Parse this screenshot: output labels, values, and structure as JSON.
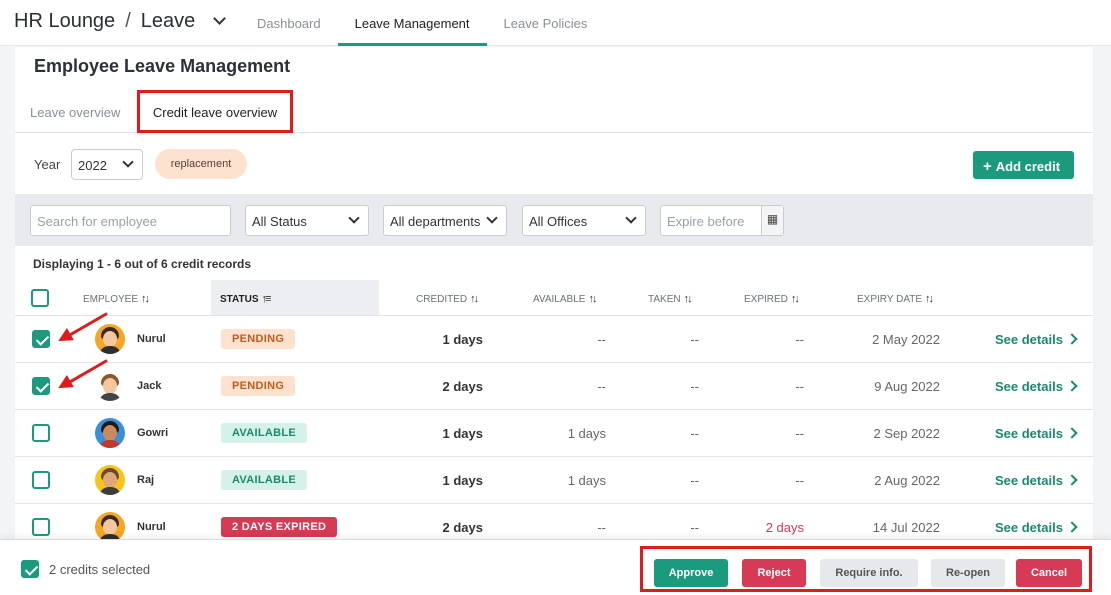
{
  "header": {
    "app_name": "HR Lounge",
    "separator": "/",
    "module": "Leave",
    "nav": [
      "Dashboard",
      "Leave Management",
      "Leave Policies"
    ],
    "active_nav": "Leave Management"
  },
  "page": {
    "title": "Employee Leave Management",
    "tabs": [
      "Leave overview",
      "Credit leave overview"
    ],
    "active_tab": "Credit leave overview"
  },
  "toolbar": {
    "year_label": "Year",
    "year_value": "2022",
    "tag": "replacement",
    "add_credit": "Add credit",
    "add_icon": "plus-icon"
  },
  "filters": {
    "search_placeholder": "Search for employee",
    "status": "All Status",
    "departments": "All departments",
    "offices": "All Offices",
    "expire_placeholder": "Expire before",
    "calendar_icon": "calendar-icon"
  },
  "table": {
    "summary": "Displaying 1 - 6 out of 6 credit records",
    "columns": {
      "employee": "EMPLOYEE",
      "status": "STATUS",
      "credited": "CREDITED",
      "available": "AVAILABLE",
      "taken": "TAKEN",
      "expired": "EXPIRED",
      "expiry_date": "EXPIRY DATE"
    },
    "rows": [
      {
        "name": "Nurul",
        "status": "PENDING",
        "credited": "1 days",
        "available": "--",
        "taken": "--",
        "expired": "--",
        "expiry": "2 May 2022",
        "action": "See details",
        "checked": true
      },
      {
        "name": "Jack",
        "status": "PENDING",
        "credited": "2 days",
        "available": "--",
        "taken": "--",
        "expired": "--",
        "expiry": "9 Aug 2022",
        "action": "See details",
        "checked": true
      },
      {
        "name": "Gowri",
        "status": "AVAILABLE",
        "credited": "1 days",
        "available": "1 days",
        "taken": "--",
        "expired": "--",
        "expiry": "2 Sep 2022",
        "action": "See details",
        "checked": false
      },
      {
        "name": "Raj",
        "status": "AVAILABLE",
        "credited": "1 days",
        "available": "1 days",
        "taken": "--",
        "expired": "--",
        "expiry": "2 Aug 2022",
        "action": "See details",
        "checked": false
      },
      {
        "name": "Nurul",
        "status": "2 DAYS EXPIRED",
        "credited": "2 days",
        "available": "--",
        "taken": "--",
        "expired": "2 days",
        "expiry": "14 Jul 2022",
        "action": "See details",
        "checked": false
      }
    ]
  },
  "footer": {
    "selected_text": "2 credits selected",
    "buttons": {
      "approve": "Approve",
      "reject": "Reject",
      "require_info": "Require info.",
      "reopen": "Re-open",
      "cancel": "Cancel"
    }
  },
  "colors": {
    "accent": "#1b9a7d",
    "danger": "#d63a54",
    "highlight": "#e01b1b",
    "pending_bg": "#fde3cf",
    "available_bg": "#d5f2ea"
  }
}
